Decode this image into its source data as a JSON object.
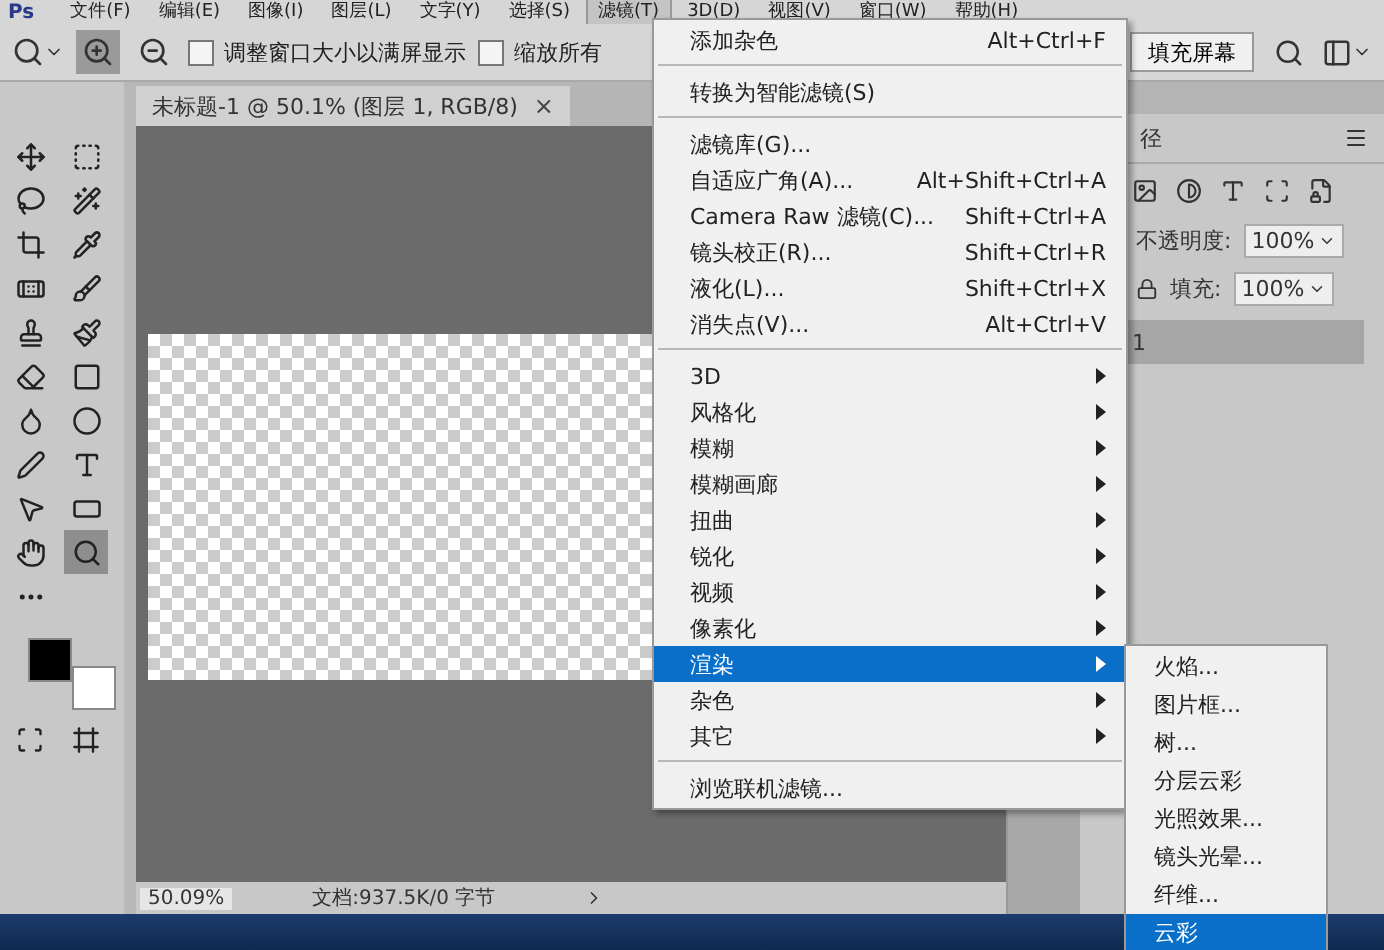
{
  "menubar": {
    "logo": "Ps",
    "items": [
      {
        "label": "文件(F)",
        "selected": false
      },
      {
        "label": "编辑(E)",
        "selected": false
      },
      {
        "label": "图像(I)",
        "selected": false
      },
      {
        "label": "图层(L)",
        "selected": false
      },
      {
        "label": "文字(Y)",
        "selected": false
      },
      {
        "label": "选择(S)",
        "selected": false
      },
      {
        "label": "滤镜(T)",
        "selected": true
      },
      {
        "label": "3D(D)",
        "selected": false
      },
      {
        "label": "视图(V)",
        "selected": false
      },
      {
        "label": "窗口(W)",
        "selected": false
      },
      {
        "label": "帮助(H)",
        "selected": false
      }
    ]
  },
  "options_bar": {
    "zoom_modes": [
      {
        "kind": "zoom-in",
        "selected": true
      },
      {
        "kind": "zoom-out",
        "selected": false
      }
    ],
    "checkboxes": [
      {
        "label": "调整窗口大小以满屏显示",
        "checked": false
      },
      {
        "label": "缩放所有",
        "checked": false
      }
    ],
    "fill_screen_button": "填充屏幕"
  },
  "document_tab": {
    "title": "未标题-1 @ 50.1% (图层 1, RGB/8)",
    "close": "×"
  },
  "tools": [
    {
      "kind": "move",
      "selected": false
    },
    {
      "kind": "marquee",
      "selected": false
    },
    {
      "kind": "lasso",
      "selected": false
    },
    {
      "kind": "wand",
      "selected": false
    },
    {
      "kind": "crop",
      "selected": false
    },
    {
      "kind": "eyedropper",
      "selected": false
    },
    {
      "kind": "heal",
      "selected": false
    },
    {
      "kind": "brush",
      "selected": false
    },
    {
      "kind": "stamp",
      "selected": false
    },
    {
      "kind": "history-brush",
      "selected": false
    },
    {
      "kind": "eraser",
      "selected": false
    },
    {
      "kind": "gradient",
      "selected": false
    },
    {
      "kind": "blur",
      "selected": false
    },
    {
      "kind": "dodge",
      "selected": false
    },
    {
      "kind": "pen",
      "selected": false
    },
    {
      "kind": "type",
      "selected": false
    },
    {
      "kind": "select",
      "selected": false
    },
    {
      "kind": "shape",
      "selected": false
    },
    {
      "kind": "hand",
      "selected": false
    },
    {
      "kind": "zoom",
      "selected": true
    },
    {
      "kind": "more",
      "selected": false
    }
  ],
  "status_bar": {
    "zoom": "50.09%",
    "document": "文档:937.5K/0 字节"
  },
  "filter_menu": [
    {
      "kind": "item",
      "label": "添加杂色",
      "shortcut": "Alt+Ctrl+F",
      "selected": false
    },
    {
      "kind": "separator"
    },
    {
      "kind": "item",
      "label": "转换为智能滤镜(S)",
      "selected": false
    },
    {
      "kind": "separator"
    },
    {
      "kind": "item",
      "label": "滤镜库(G)...",
      "selected": false
    },
    {
      "kind": "item",
      "label": "自适应广角(A)...",
      "shortcut": "Alt+Shift+Ctrl+A",
      "selected": false
    },
    {
      "kind": "item",
      "label": "Camera Raw 滤镜(C)...",
      "shortcut": "Shift+Ctrl+A",
      "selected": false
    },
    {
      "kind": "item",
      "label": "镜头校正(R)...",
      "shortcut": "Shift+Ctrl+R",
      "selected": false
    },
    {
      "kind": "item",
      "label": "液化(L)...",
      "shortcut": "Shift+Ctrl+X",
      "selected": false
    },
    {
      "kind": "item",
      "label": "消失点(V)...",
      "shortcut": "Alt+Ctrl+V",
      "selected": false
    },
    {
      "kind": "separator"
    },
    {
      "kind": "submenu",
      "label": "3D",
      "selected": false
    },
    {
      "kind": "submenu",
      "label": "风格化",
      "selected": false
    },
    {
      "kind": "submenu",
      "label": "模糊",
      "selected": false
    },
    {
      "kind": "submenu",
      "label": "模糊画廊",
      "selected": false
    },
    {
      "kind": "submenu",
      "label": "扭曲",
      "selected": false
    },
    {
      "kind": "submenu",
      "label": "锐化",
      "selected": false
    },
    {
      "kind": "submenu",
      "label": "视频",
      "selected": false
    },
    {
      "kind": "submenu",
      "label": "像素化",
      "selected": false
    },
    {
      "kind": "submenu",
      "label": "渲染",
      "selected": true
    },
    {
      "kind": "submenu",
      "label": "杂色",
      "selected": false
    },
    {
      "kind": "submenu",
      "label": "其它",
      "selected": false
    },
    {
      "kind": "separator"
    },
    {
      "kind": "item",
      "label": "浏览联机滤镜...",
      "selected": false
    }
  ],
  "render_submenu": [
    {
      "label": "火焰...",
      "selected": false
    },
    {
      "label": "图片框...",
      "selected": false
    },
    {
      "label": "树...",
      "selected": false
    },
    {
      "label": "分层云彩",
      "selected": false
    },
    {
      "label": "光照效果...",
      "selected": false
    },
    {
      "label": "镜头光晕...",
      "selected": false
    },
    {
      "label": "纤维...",
      "selected": false
    },
    {
      "label": "云彩",
      "selected": true
    }
  ],
  "layers_panel": {
    "tab": "径",
    "opacity_label": "不透明度:",
    "opacity": "100%",
    "fill_label": "填充:",
    "fill": "100%",
    "layers": [
      {
        "name": "1",
        "selected": true
      }
    ]
  }
}
